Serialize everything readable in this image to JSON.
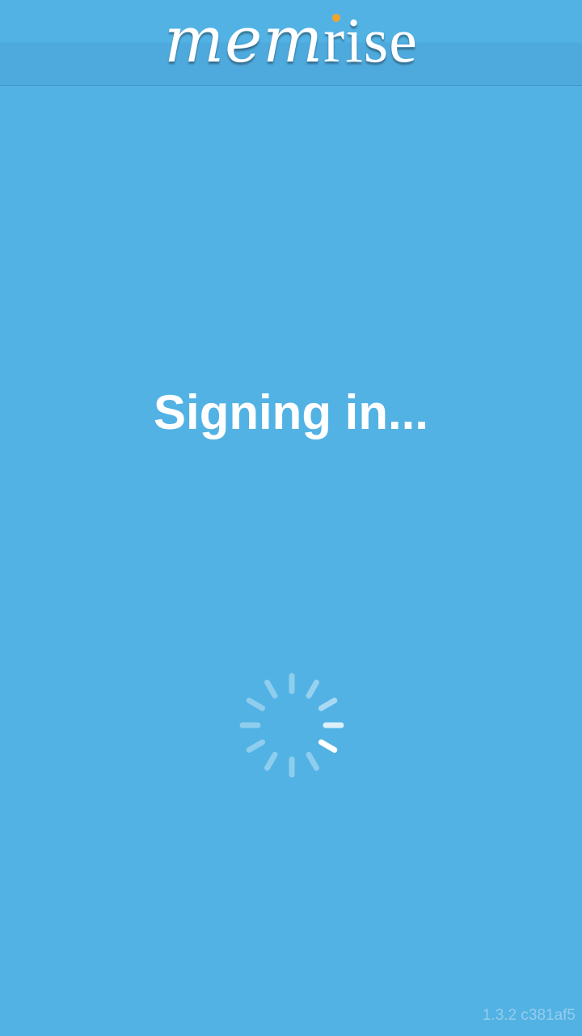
{
  "header": {
    "logo_part1": "mem",
    "logo_part2": "rise",
    "brand_color": "#52b2e4",
    "dot_color": "#f3a42c"
  },
  "status": {
    "text": "Signing in..."
  },
  "spinner": {
    "icon": "loading-spinner-icon"
  },
  "footer": {
    "version": "1.3.2 c381af5"
  }
}
